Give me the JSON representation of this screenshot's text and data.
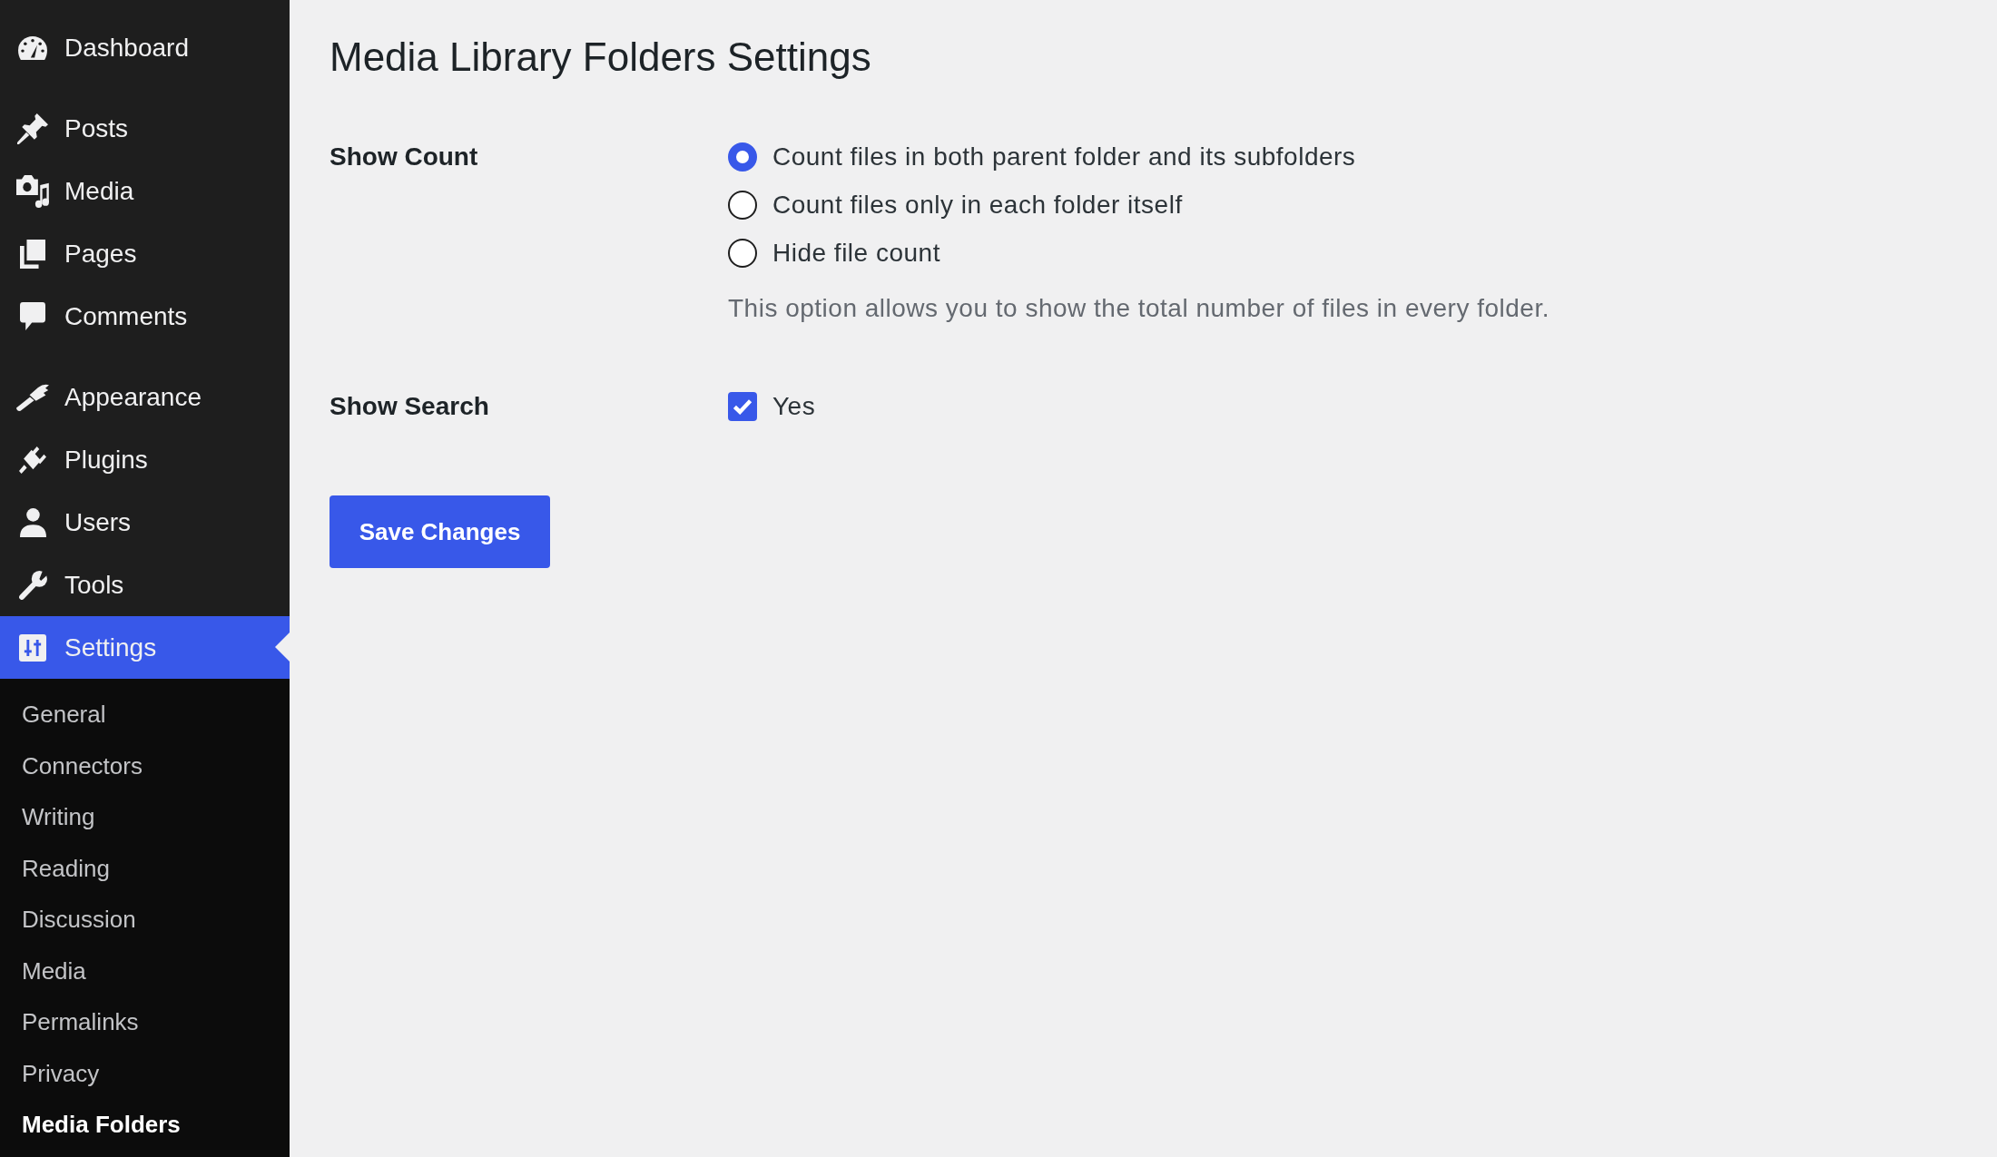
{
  "sidebar": {
    "sections": [
      {
        "items": [
          {
            "label": "Dashboard",
            "selected": false
          }
        ]
      },
      {
        "items": [
          {
            "label": "Posts",
            "selected": false
          },
          {
            "label": "Media",
            "selected": false
          },
          {
            "label": "Pages",
            "selected": false
          },
          {
            "label": "Comments",
            "selected": false
          }
        ]
      },
      {
        "items": [
          {
            "label": "Appearance",
            "selected": false
          },
          {
            "label": "Plugins",
            "selected": false
          },
          {
            "label": "Users",
            "selected": false
          },
          {
            "label": "Tools",
            "selected": false
          },
          {
            "label": "Settings",
            "selected": true,
            "submenu": [
              {
                "label": "General",
                "selected": false
              },
              {
                "label": "Connectors",
                "selected": false
              },
              {
                "label": "Writing",
                "selected": false
              },
              {
                "label": "Reading",
                "selected": false
              },
              {
                "label": "Discussion",
                "selected": false
              },
              {
                "label": "Media",
                "selected": false
              },
              {
                "label": "Permalinks",
                "selected": false
              },
              {
                "label": "Privacy",
                "selected": false
              },
              {
                "label": "Media Folders",
                "selected": true
              }
            ]
          }
        ]
      }
    ]
  },
  "page": {
    "title": "Media Library Folders Settings"
  },
  "form": {
    "rows": [
      {
        "kind": "radio",
        "label": "Show Count",
        "options": [
          {
            "label": "Count files in both parent folder and its subfolders",
            "selected": true
          },
          {
            "label": "Count files only in each folder itself",
            "selected": false
          },
          {
            "label": "Hide file count",
            "selected": false
          }
        ],
        "description": "This option allows you to show the total number of files in every folder."
      },
      {
        "kind": "checkbox",
        "label": "Show Search",
        "options": [
          {
            "label": "Yes",
            "checked": true
          }
        ]
      }
    ],
    "submit_button": {
      "label": "Save Changes"
    }
  }
}
